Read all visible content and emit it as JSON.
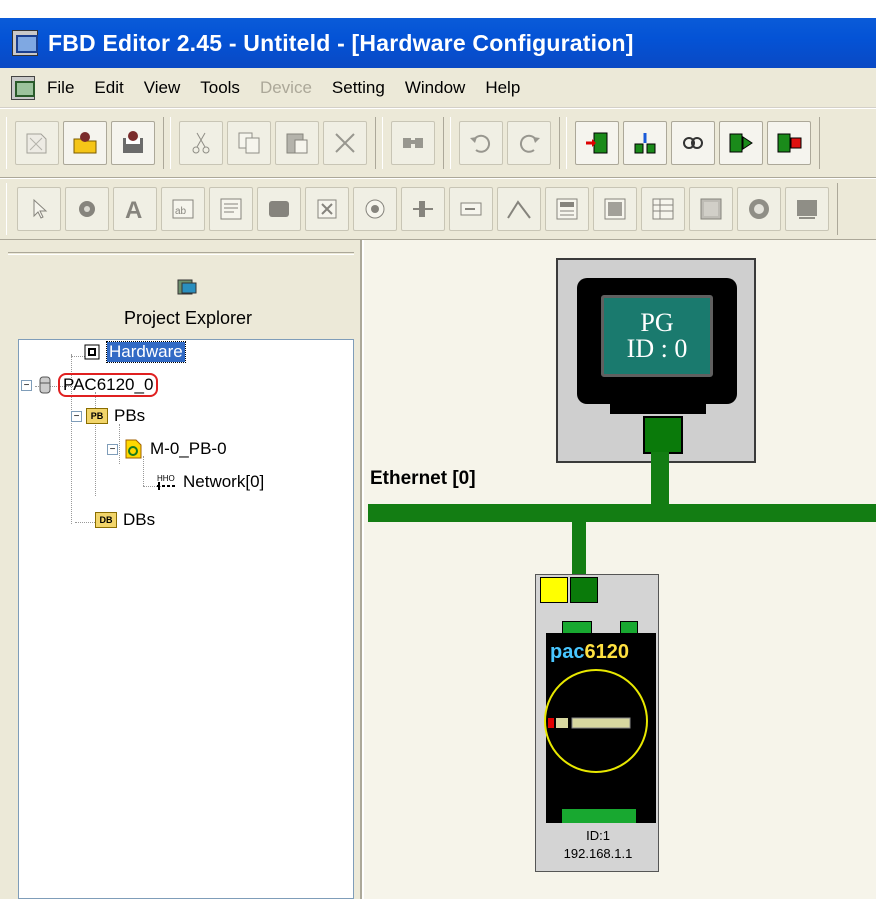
{
  "window": {
    "title": "FBD Editor 2.45 - Untiteld - [Hardware Configuration]"
  },
  "menu": {
    "items": [
      {
        "label": "File",
        "enabled": true
      },
      {
        "label": "Edit",
        "enabled": true
      },
      {
        "label": "View",
        "enabled": true
      },
      {
        "label": "Tools",
        "enabled": true
      },
      {
        "label": "Device",
        "enabled": false
      },
      {
        "label": "Setting",
        "enabled": true
      },
      {
        "label": "Window",
        "enabled": true
      },
      {
        "label": "Help",
        "enabled": true
      }
    ]
  },
  "toolbar1": {
    "icons": [
      "new-icon",
      "open-icon",
      "save-icon",
      "cut-icon",
      "copy-icon",
      "paste-icon",
      "delete-icon",
      "find-icon",
      "undo-icon",
      "redo-icon",
      "download-icon",
      "upload-icon",
      "connect-icon",
      "run-icon",
      "stop-icon"
    ]
  },
  "toolbar2": {
    "icons": [
      "pointer-icon",
      "hand-icon",
      "text-icon",
      "numeric-icon",
      "listbox-icon",
      "button-icon",
      "checkbox-icon",
      "radio-icon",
      "slider-icon",
      "edit-box-icon",
      "trend-icon",
      "panel-icon",
      "grid-icon",
      "table-icon",
      "image-icon",
      "gear-icon",
      "frame-icon"
    ]
  },
  "explorer": {
    "title": "Project Explorer",
    "tree": {
      "hardware": "Hardware",
      "device": "PAC6120_0",
      "pbs": "PBs",
      "pb_item": "M-0_PB-0",
      "network": "Network[0]",
      "dbs": "DBs"
    },
    "badges": {
      "pb": "PB",
      "db": "DB"
    }
  },
  "canvas": {
    "pg": {
      "line1": "PG",
      "line2": "ID : 0"
    },
    "bus_label": "Ethernet [0]",
    "pac": {
      "brand_a": "pac",
      "brand_b": "6120",
      "id_line": "ID:1",
      "ip": "192.168.1.1"
    }
  },
  "colors": {
    "titlebar": "#0453d6",
    "bus": "#137d13",
    "selection": "#316ac5",
    "highlight_ring": "#e02020"
  }
}
